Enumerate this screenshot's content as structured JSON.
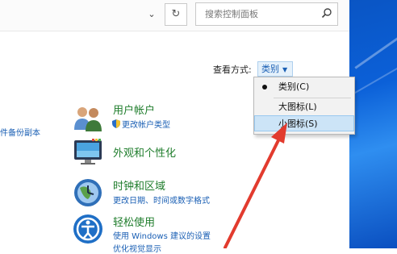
{
  "search": {
    "placeholder": "搜索控制面板"
  },
  "view_by": {
    "label": "查看方式:",
    "current": "类别"
  },
  "view_menu": {
    "items": [
      {
        "label": "类别(C)",
        "selected": true
      },
      {
        "label": "大图标(L)",
        "selected": false
      },
      {
        "label": "小图标(S)",
        "selected": false,
        "highlighted": true
      }
    ]
  },
  "left_partial_link": "件备份副本",
  "categories": [
    {
      "title": "用户帐户",
      "links": [
        "更改帐户类型"
      ]
    },
    {
      "title": "外观和个性化",
      "links": []
    },
    {
      "title": "时钟和区域",
      "links": [
        "更改日期、时间或数字格式"
      ]
    },
    {
      "title": "轻松使用",
      "links": [
        "使用 Windows 建议的设置",
        "优化视觉显示"
      ]
    }
  ],
  "colors": {
    "category_title": "#1f7d2c",
    "link": "#1a5fb4",
    "highlight": "#cce4f7",
    "annotation_arrow": "#e23b2e"
  }
}
